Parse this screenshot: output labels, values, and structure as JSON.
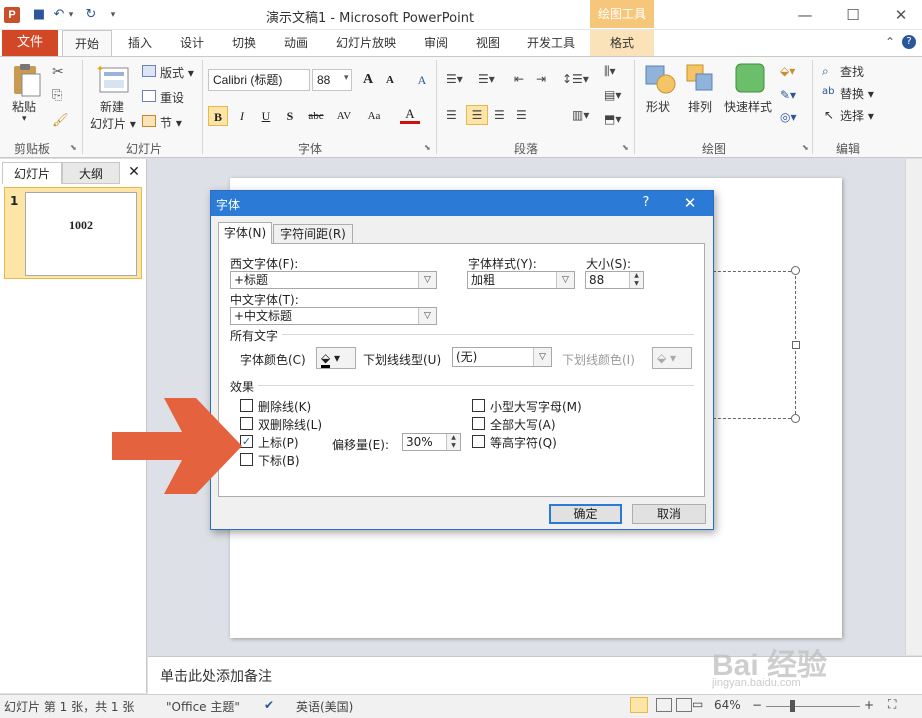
{
  "window": {
    "title": "演示文稿1 - Microsoft PowerPoint",
    "context_tab_header": "绘图工具",
    "app_icon_letter": "P",
    "controls": {
      "minimize": "—",
      "maximize": "☐",
      "close": "✕"
    }
  },
  "quick_access": {
    "save": "■",
    "undo": "↶",
    "undo_drop": "▾",
    "redo": "↻",
    "customize": "▾"
  },
  "tabs": [
    "文件",
    "开始",
    "插入",
    "设计",
    "切换",
    "动画",
    "幻灯片放映",
    "审阅",
    "视图",
    "开发工具",
    "格式"
  ],
  "ribbon": {
    "clipboard": {
      "label": "剪贴板",
      "paste": "粘贴",
      "paste_drop": "▾"
    },
    "slides": {
      "label": "幻灯片",
      "new_slide_1": "新建",
      "new_slide_2": "幻灯片 ▾",
      "layout": "版式 ▾",
      "reset": "重设",
      "section": "节 ▾"
    },
    "font": {
      "label": "字体",
      "font_name": "Calibri (标题)",
      "font_size": "88",
      "grow": "A",
      "shrink": "A",
      "clear": "A",
      "bold": "B",
      "italic": "I",
      "underline": "U",
      "shadow": "S",
      "strike": "abc",
      "spacing": "AV",
      "case": "Aa",
      "color": "A"
    },
    "paragraph": {
      "label": "段落"
    },
    "drawing": {
      "label": "绘图",
      "shapes": "形状",
      "arrange": "排列",
      "quick_styles": "快速样式"
    },
    "editing": {
      "label": "编辑",
      "find": "查找",
      "replace": "替换 ▾",
      "select": "选择 ▾"
    }
  },
  "left_pane": {
    "tab_slides": "幻灯片",
    "tab_outline": "大纲",
    "close": "✕",
    "slide_number": "1",
    "slide_text": "1002"
  },
  "notes_placeholder": "单击此处添加备注",
  "status": {
    "slide_info": "幻灯片 第 1 张，共 1 张",
    "theme": "\"Office 主题\"",
    "language": "英语(美国)",
    "zoom": "64%",
    "zoom_minus": "−",
    "zoom_plus": "+"
  },
  "dialog": {
    "title": "字体",
    "help": "?",
    "close": "✕",
    "tab_font": "字体(N)",
    "tab_spacing": "字符间距(R)",
    "latin_font_label": "西文字体(F):",
    "latin_font_value": "+标题",
    "style_label": "字体样式(Y):",
    "style_value": "加粗",
    "size_label": "大小(S):",
    "size_value": "88",
    "asian_font_label": "中文字体(T):",
    "asian_font_value": "+中文标题",
    "all_text_header": "所有文字",
    "font_color_label": "字体颜色(C)",
    "underline_type_label": "下划线线型(U)",
    "underline_type_value": "(无)",
    "underline_color_label": "下划线颜色(I)",
    "effects_header": "效果",
    "effects": {
      "strikethrough": "删除线(K)",
      "double_strikethrough": "双删除线(L)",
      "superscript": "上标(P)",
      "subscript": "下标(B)",
      "small_caps": "小型大写字母(M)",
      "all_caps": "全部大写(A)",
      "equalize_height": "等高字符(Q)"
    },
    "superscript_checked": "✓",
    "offset_label": "偏移量(E):",
    "offset_value": "30%",
    "ok": "确定",
    "cancel": "取消"
  },
  "watermark": {
    "line1": "Bai 经验",
    "line2": "jingyan.baidu.com"
  },
  "colors": {
    "file_tab": "#d24726",
    "context_tab": "#f6c77b",
    "dialog_title": "#2b7bd6",
    "arrow": "#e4633e"
  }
}
